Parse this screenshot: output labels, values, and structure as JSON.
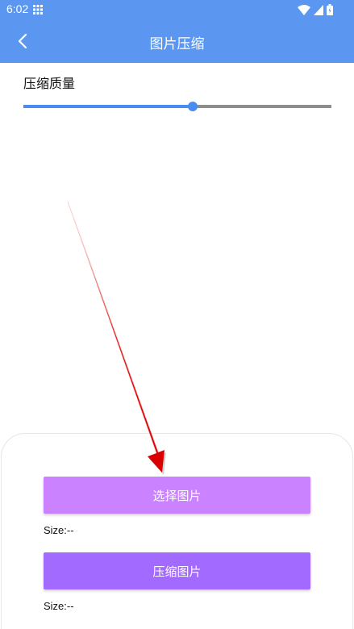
{
  "status_bar": {
    "time": "6:02",
    "icons": [
      "grid-icon",
      "wifi-icon",
      "signal-icon",
      "battery-icon"
    ]
  },
  "app_bar": {
    "title": "图片压缩",
    "back_icon": "chevron-left-icon"
  },
  "quality": {
    "label": "压缩质量",
    "slider_value": 0.55
  },
  "actions": {
    "select_label": "选择图片",
    "select_size": "Size:--",
    "compress_label": "压缩图片",
    "compress_size": "Size:--"
  },
  "colors": {
    "primary": "#5b97f0",
    "slider_accent": "#4a8df0",
    "select_button": "#ca82ff",
    "compress_button": "#a26aff",
    "annotation_arrow": "#e80000"
  }
}
